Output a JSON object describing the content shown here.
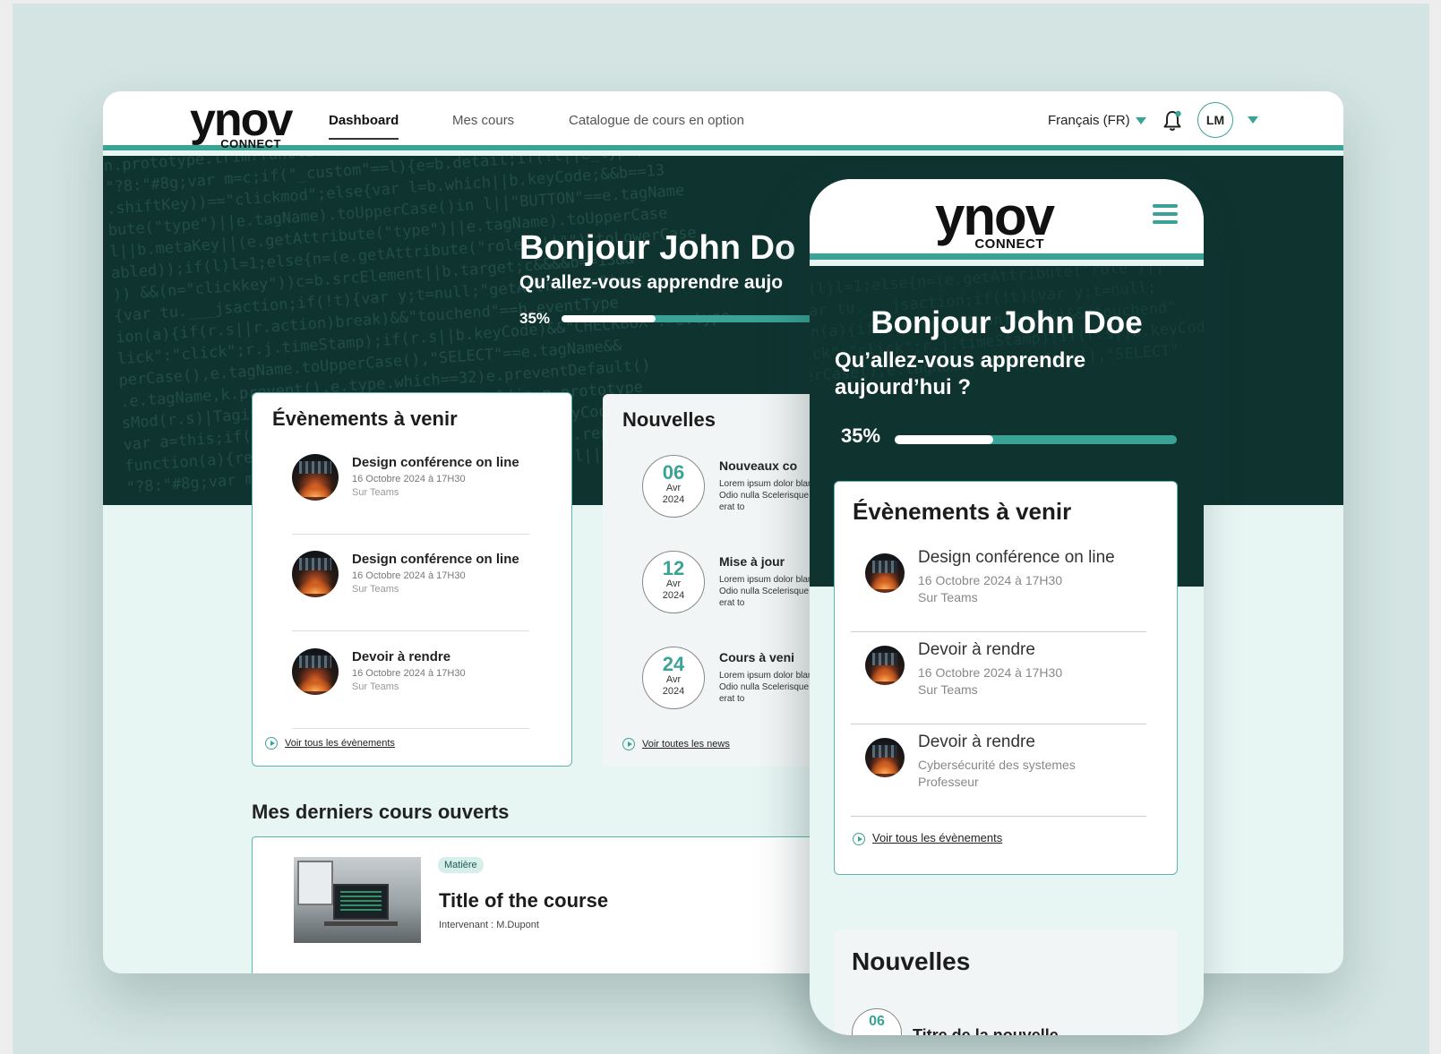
{
  "desktop": {
    "logo": {
      "main": "ynov",
      "sub": "CONNECT"
    },
    "nav": [
      "Dashboard",
      "Mes cours",
      "Catalogue de cours en option"
    ],
    "language": "Français (FR)",
    "user_initials": "LM",
    "hero": {
      "title": "Bonjour John Do",
      "subtitle": "Qu’allez-vous apprendre aujo",
      "progress_label": "35%",
      "progress_value": 0.35
    },
    "events": {
      "title": "Évènements à venir",
      "items": [
        {
          "title": "Design conférence on line",
          "date": "16 Octobre 2024 à 17H30",
          "location": "Sur Teams"
        },
        {
          "title": "Design conférence on line",
          "date": "16 Octobre 2024 à 17H30",
          "location": "Sur Teams"
        },
        {
          "title": "Devoir à rendre",
          "date": "16 Octobre 2024 à 17H30",
          "location": "Sur Teams"
        }
      ],
      "link": "Voir tous les évènements"
    },
    "news": {
      "title": "Nouvelles",
      "items": [
        {
          "day": "06",
          "month": "Avr",
          "year": "2024",
          "title": "Nouveaux co",
          "text": "Lorem ipsum dolor blandit. Odio nulla Scelerisque erat to"
        },
        {
          "day": "12",
          "month": "Avr",
          "year": "2024",
          "title": "Mise à jour",
          "text": "Lorem ipsum dolor blandit. Odio nulla Scelerisque erat to"
        },
        {
          "day": "24",
          "month": "Avr",
          "year": "2024",
          "title": "Cours à veni",
          "text": "Lorem ipsum dolor blandit. Odio nulla Scelerisque erat to"
        }
      ],
      "link": "Voir toutes les news"
    },
    "courses": {
      "title": "Mes derniers cours ouverts",
      "badge": "Matière",
      "course_title": "Title of the course",
      "teacher": "Intervenant : M.Dupont"
    }
  },
  "mobile": {
    "logo": {
      "main": "ynov",
      "sub": "CONNECT"
    },
    "hero": {
      "title": "Bonjour John Doe",
      "subtitle": "Qu’allez-vous apprendre aujourd’hui ?",
      "progress_label": "35%",
      "progress_value": 0.35
    },
    "events": {
      "title": "Évènements à venir",
      "items": [
        {
          "title": "Design conférence on line",
          "line1": "16 Octobre 2024 à 17H30",
          "line2": "Sur Teams"
        },
        {
          "title": "Devoir à rendre",
          "line1": "16 Octobre 2024 à 17H30",
          "line2": "Sur Teams"
        },
        {
          "title": "Devoir à rendre",
          "line1": "Cybersécurité des systemes",
          "line2": "Professeur"
        }
      ],
      "link": "Voir tous les évènements"
    },
    "news": {
      "title": "Nouvelles",
      "first_day": "06",
      "first_title": "Titre de la nouvelle"
    }
  },
  "colors": {
    "accent": "#3aa396",
    "hero_bg": "#0f3430",
    "page_bg": "#e7f5f3",
    "stage_bg": "#d3e4e2"
  },
  "icons": {
    "bell": "bell-icon",
    "menu": "hamburger-menu-icon",
    "caret": "caret-down-icon",
    "link": "play-circle-icon"
  }
}
